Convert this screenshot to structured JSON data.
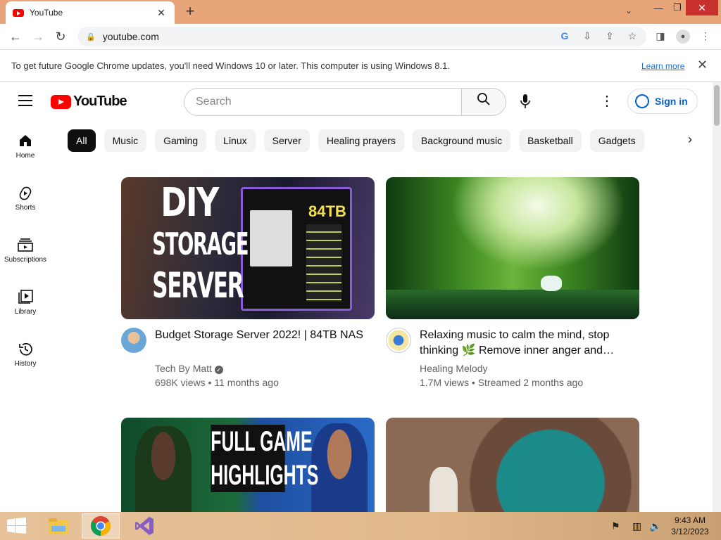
{
  "browser": {
    "tab_title": "YouTube",
    "tab_close": "✕",
    "new_tab": "+",
    "url": "youtube.com",
    "window_controls": {
      "minimize": "—",
      "restore": "❐",
      "close": "✕"
    }
  },
  "infobar": {
    "message": "To get future Google Chrome updates, you'll need Windows 10 or later. This computer is using Windows 8.1.",
    "learn_more": "Learn more",
    "close": "✕"
  },
  "masthead": {
    "logo_text": "YouTube",
    "search_placeholder": "Search",
    "sign_in": "Sign in"
  },
  "chips": [
    "All",
    "Music",
    "Gaming",
    "Linux",
    "Server",
    "Healing prayers",
    "Background music",
    "Basketball",
    "Gadgets"
  ],
  "guide": [
    {
      "label": "Home",
      "icon": "home-icon"
    },
    {
      "label": "Shorts",
      "icon": "shorts-icon"
    },
    {
      "label": "Subscriptions",
      "icon": "subscriptions-icon"
    },
    {
      "label": "Library",
      "icon": "library-icon"
    },
    {
      "label": "History",
      "icon": "history-icon"
    }
  ],
  "videos": [
    {
      "title": "Budget Storage Server 2022! | 84TB NAS",
      "channel": "Tech By Matt",
      "verified": true,
      "stats": "698K views • 11 months ago",
      "thumb_text": [
        "DIY",
        "STORAGE",
        "SERVER"
      ],
      "thumb_badge": "84TB"
    },
    {
      "title": "Relaxing music to calm the mind, stop thinking 🌿 Remove inner anger and…",
      "channel": "Healing Melody",
      "verified": false,
      "stats": "1.7M views • Streamed 2 months ago"
    },
    {
      "thumb_text": [
        "FULL GAME",
        "HIGHLIGHTS"
      ]
    },
    {}
  ],
  "taskbar": {
    "time": "9:43 AM",
    "date": "3/12/2023"
  },
  "colors": {
    "titlebar": "#e8a57a",
    "youtube_red": "#ff0000",
    "link_blue": "#065fd4",
    "win_close": "#c7302c"
  }
}
